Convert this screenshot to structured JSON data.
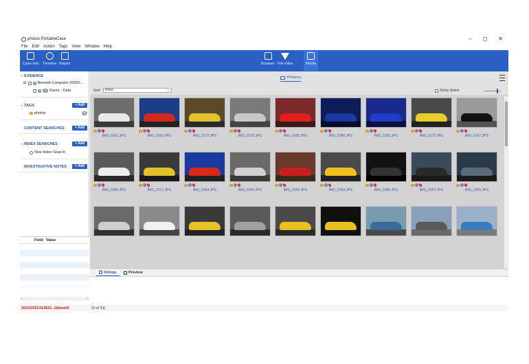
{
  "window": {
    "title": "photos.PortableCase",
    "controls": [
      "–",
      "◻",
      "✕"
    ]
  },
  "menu": [
    "File",
    "Edit",
    "Action",
    "Tags",
    "View",
    "Window",
    "Help"
  ],
  "ribbon": {
    "case_info": "Case Info",
    "timeline": "Timeline",
    "report": "Report",
    "browser": "Browser",
    "file_filter": "File Filter",
    "media": "Media"
  },
  "sidebar": {
    "evidence_label": "EVIDENCE",
    "evidence_root": "Bennett-Computer-20052...",
    "evidence_child": "Racer - Data",
    "evidence_child_badge": "2",
    "tags_label": "TAGS",
    "tag_name": "photos",
    "tag_count": "31",
    "content_searches_label": "CONTENT SEARCHES",
    "index_searches_label": "INDEX SEARCHES",
    "new_index_search": "New Index Search",
    "investigative_notes_label": "INVESTIGATIVE NOTES",
    "add_label": "+ Add"
  },
  "field_panel": {
    "field_header": "Field",
    "value_header": "Value"
  },
  "main": {
    "pictures_tab": "Pictures",
    "sort_label": "Sort:",
    "sort_value": "None",
    "sticky_select": "Sticky Select"
  },
  "thumbnails": [
    {
      "name": "IMG_0161.JPG",
      "bg": "#6e6e6e",
      "car": "#e8e8e8",
      "floor": "#3a3a3a"
    },
    {
      "name": "IMG_0162.JPG",
      "bg": "#1b3e8a",
      "car": "#d02a1c",
      "floor": "#222"
    },
    {
      "name": "IMG_0172.JPG",
      "bg": "#5a4a2a",
      "car": "#e3c12a",
      "floor": "#2b2b2b"
    },
    {
      "name": "IMG_0153.JPG",
      "bg": "#7a7a7a",
      "car": "#c8c8c8",
      "floor": "#444"
    },
    {
      "name": "IMG_0182.JPG",
      "bg": "#7a2a2a",
      "car": "#e02020",
      "floor": "#3a1a1a"
    },
    {
      "name": "IMG_0186.JPG",
      "bg": "#0c1d5a",
      "car": "#1a3aa0",
      "floor": "#0a0a2a"
    },
    {
      "name": "IMG_0185.JPG",
      "bg": "#1a2a8a",
      "car": "#1e3ec8",
      "floor": "#0a1040"
    },
    {
      "name": "IMG_0173.JPG",
      "bg": "#4a4a4a",
      "car": "#e6cf2a",
      "floor": "#222"
    },
    {
      "name": "IMG_0157.JPG",
      "bg": "#9a9a9a",
      "car": "#111",
      "floor": "#555"
    },
    {
      "name": "IMG_0160.JPG",
      "bg": "#5a5a5a",
      "car": "#eee",
      "floor": "#2a2a2a"
    },
    {
      "name": "IMG_0171.JPG",
      "bg": "#3a3a3a",
      "car": "#e3c12a",
      "floor": "#1a1a1a"
    },
    {
      "name": "IMG_0164.JPG",
      "bg": "#1a3aa0",
      "car": "#d82a1c",
      "floor": "#222"
    },
    {
      "name": "IMG_0154.JPG",
      "bg": "#6a6a6a",
      "car": "#d0d0d0",
      "floor": "#3a3a3a"
    },
    {
      "name": "IMG_0165.JPG",
      "bg": "#6a3a2a",
      "car": "#c82020",
      "floor": "#3a2a1a"
    },
    {
      "name": "IMG_0169.JPG",
      "bg": "#4a4a4a",
      "car": "#f0c020",
      "floor": "#222"
    },
    {
      "name": "IMG_0180.JPG",
      "bg": "#121212",
      "car": "#333",
      "floor": "#000"
    },
    {
      "name": "IMG_0167.JPG",
      "bg": "#3a4a5a",
      "car": "#2a2a2a",
      "floor": "#1a1a1a"
    },
    {
      "name": "IMG_0155.JPG",
      "bg": "#2a3a4a",
      "car": "#5a6a7a",
      "floor": "#1a1a1a"
    },
    {
      "name": "",
      "bg": "#6a6a6a",
      "car": "#cfcfcf",
      "floor": "#333"
    },
    {
      "name": "",
      "bg": "#8a8a8a",
      "car": "#f0f0f0",
      "floor": "#444"
    },
    {
      "name": "",
      "bg": "#3a3a3a",
      "car": "#e8c22a",
      "floor": "#222"
    },
    {
      "name": "",
      "bg": "#5a5a5a",
      "car": "#a0a0a0",
      "floor": "#2a2a2a"
    },
    {
      "name": "",
      "bg": "#4a4a4a",
      "car": "#e8c020",
      "floor": "#2a2a2a"
    },
    {
      "name": "",
      "bg": "#111111",
      "car": "#e8c020",
      "floor": "#111"
    },
    {
      "name": "",
      "bg": "#7a9ab0",
      "car": "#3a6a9a",
      "floor": "#4a4a4a"
    },
    {
      "name": "",
      "bg": "#8aa0b8",
      "car": "#5a5a5a",
      "floor": "#6a6a6a"
    },
    {
      "name": "",
      "bg": "#9ab0c8",
      "car": "#3a7ac0",
      "floor": "#7a7a7a"
    }
  ],
  "bottom_tabs": {
    "strings": "Strings",
    "preview": "Preview"
  },
  "status": {
    "case_id": "20210323.012622..10deeb9",
    "count": "(9 of 31)"
  },
  "colors": {
    "ribbon": "#2a5fc4",
    "link": "#3057b0",
    "status_red": "#d01818"
  }
}
